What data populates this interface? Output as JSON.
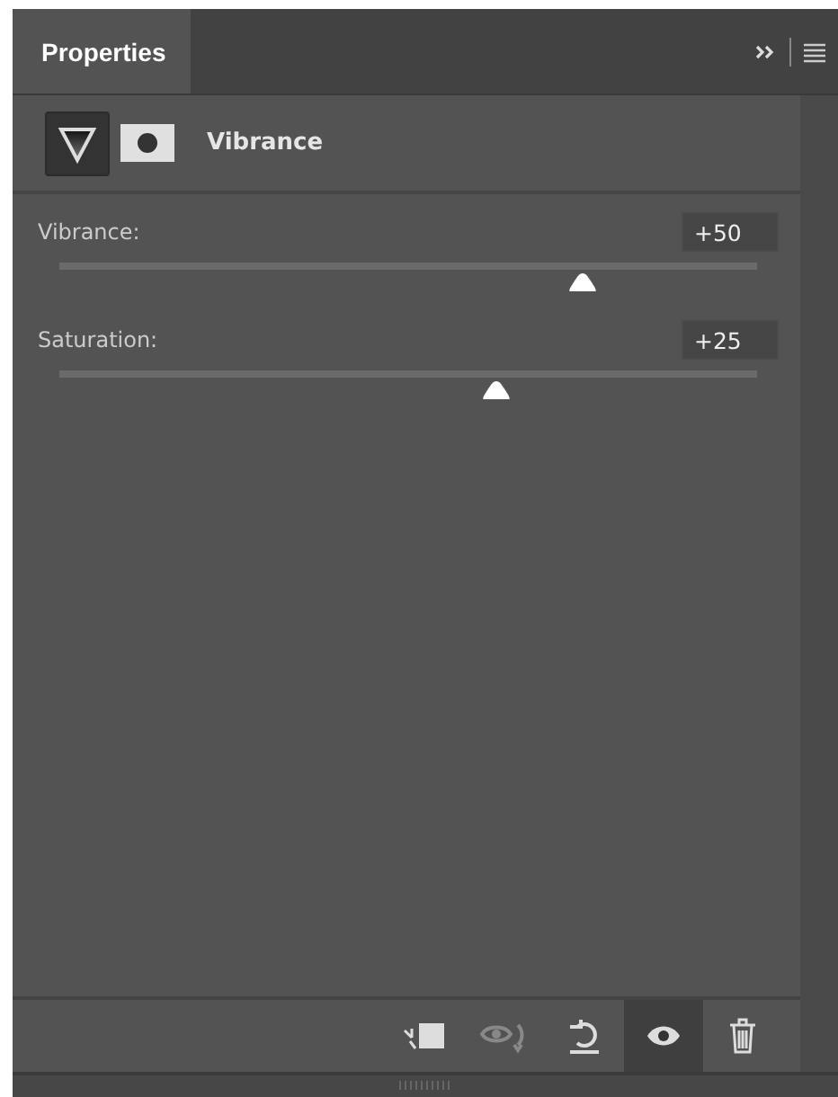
{
  "tabs": [
    {
      "label": "Properties",
      "selected": true
    }
  ],
  "header": {
    "title": "Vibrance"
  },
  "sliders": [
    {
      "label": "Vibrance:",
      "value": "+50",
      "level": 0.75
    },
    {
      "label": "Saturation:",
      "value": "+25",
      "level": 0.625
    }
  ],
  "toolbar": [
    {
      "kind": "clip",
      "selected": false,
      "disabled": false
    },
    {
      "kind": "preview-toggle",
      "selected": false,
      "disabled": true
    },
    {
      "kind": "reset",
      "selected": false,
      "disabled": false
    },
    {
      "kind": "visibility",
      "selected": true,
      "disabled": false
    },
    {
      "kind": "delete",
      "selected": false,
      "disabled": false
    }
  ]
}
